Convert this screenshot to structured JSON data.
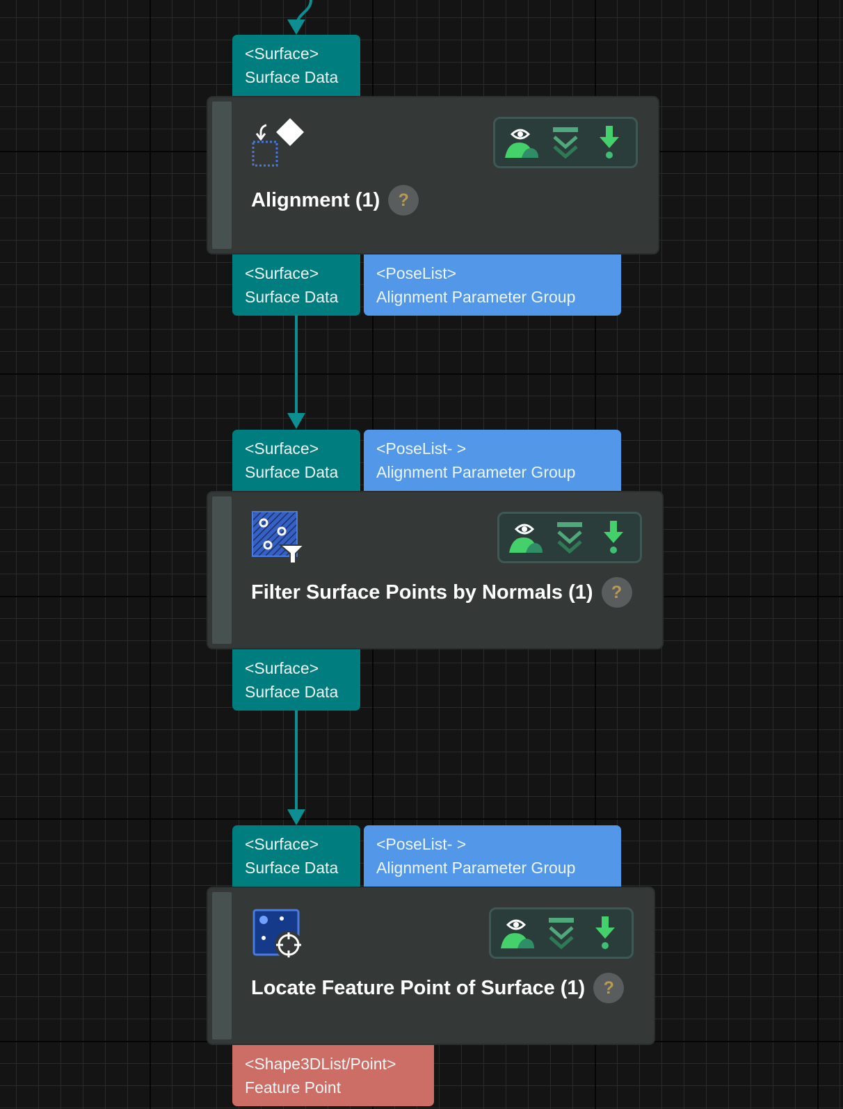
{
  "nodes": [
    {
      "title": "Alignment (1)",
      "icon": "alignment-icon",
      "inputs": [
        {
          "type": "<Surface>",
          "name": "Surface Data"
        }
      ],
      "outputs": [
        {
          "type": "<Surface>",
          "name": "Surface Data"
        },
        {
          "type": "<PoseList>",
          "name": "Alignment Parameter Group"
        }
      ]
    },
    {
      "title": "Filter Surface Points by Normals (1)",
      "icon": "filter-surface-points-icon",
      "inputs": [
        {
          "type": "<Surface>",
          "name": "Surface Data"
        },
        {
          "type": "<PoseList- >",
          "name": "Alignment Parameter Group"
        }
      ],
      "outputs": [
        {
          "type": "<Surface>",
          "name": "Surface Data"
        }
      ]
    },
    {
      "title": "Locate Feature Point of Surface (1)",
      "icon": "locate-feature-point-icon",
      "inputs": [
        {
          "type": "<Surface>",
          "name": "Surface Data"
        },
        {
          "type": "<PoseList- >",
          "name": "Alignment Parameter Group"
        }
      ],
      "outputs": [
        {
          "type": "<Shape3DList/Point>",
          "name": "Feature Point"
        }
      ]
    }
  ],
  "help_symbol": "?",
  "toolbar_icons": [
    "visualize-output-icon",
    "collapse-ports-icon",
    "download-debug-icon"
  ],
  "colors": {
    "surface_port": "#007d7e",
    "poselist_port": "#5297e8",
    "feature_port": "#cd6e66",
    "connector": "#0d8f91",
    "node_bg": "#343837",
    "icon_green": "#44d06b"
  }
}
